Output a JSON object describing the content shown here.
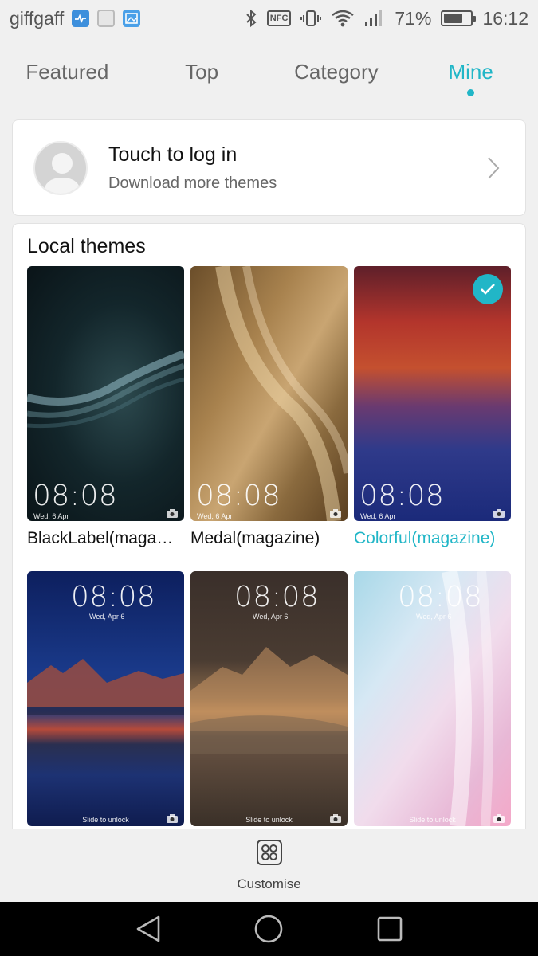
{
  "status": {
    "carrier": "giffgaff",
    "battery_pct": 71,
    "battery_text": "71%",
    "time": "16:12",
    "icons": [
      "health-app-icon",
      "circle-app-icon",
      "gallery-app-icon",
      "bluetooth-icon",
      "nfc-icon",
      "vibrate-icon",
      "wifi-icon",
      "signal-icon",
      "battery-icon"
    ],
    "nfc_label": "NFC"
  },
  "tabs": [
    {
      "label": "Featured",
      "active": false
    },
    {
      "label": "Top",
      "active": false
    },
    {
      "label": "Category",
      "active": false
    },
    {
      "label": "Mine",
      "active": true
    }
  ],
  "login": {
    "title": "Touch to log in",
    "subtitle": "Download more themes"
  },
  "local_themes": {
    "title": "Local themes",
    "items": [
      {
        "name": "BlackLabel(maga…",
        "time": "08:08",
        "date": "Wed, 6 Apr",
        "selected": false
      },
      {
        "name": "Medal(magazine)",
        "time": "08:08",
        "date": "Wed, 6 Apr",
        "selected": false
      },
      {
        "name": "Colorful(magazine)",
        "time": "08:08",
        "date": "Wed, 6 Apr",
        "selected": true
      },
      {
        "time": "08:08",
        "date": "Wed, Apr 6",
        "slide": "Slide to unlock"
      },
      {
        "time": "08:08",
        "date": "Wed, Apr 6",
        "slide": "Slide to unlock"
      },
      {
        "time": "08:08",
        "date": "Wed, Apr 6",
        "slide": "Slide to unlock"
      }
    ]
  },
  "bottom": {
    "customise_label": "Customise"
  },
  "colors": {
    "accent": "#21b6c7",
    "background": "#f0f0f0",
    "card": "#ffffff"
  }
}
